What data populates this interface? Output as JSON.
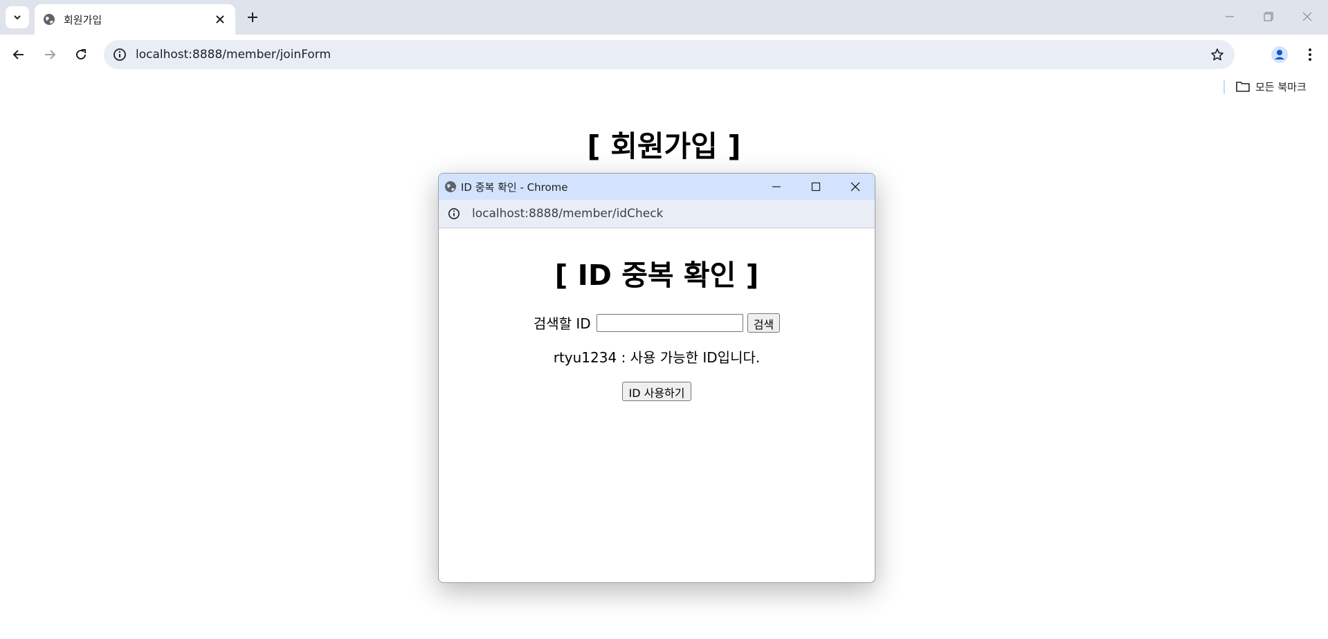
{
  "browser": {
    "tab_title": "회원가입",
    "url": "localhost:8888/member/joinForm",
    "bookmarks_all_label": "모든 북마크"
  },
  "page": {
    "heading": "[ 회원가입 ]"
  },
  "popup": {
    "window_title": "ID 중복 확인 - Chrome",
    "url": "localhost:8888/member/idCheck",
    "heading": "[ ID 중복 확인 ]",
    "search_label": "검색할 ID",
    "search_value": "",
    "search_button": "검색",
    "result_id": "rtyu1234",
    "result_message": " : 사용 가능한 ID입니다.",
    "use_button": "ID 사용하기"
  },
  "icons": [
    "tab-search-icon",
    "globe-icon",
    "close-icon",
    "plus-icon",
    "minimize-icon",
    "maximize-icon",
    "back-icon",
    "forward-icon",
    "reload-icon",
    "info-icon",
    "star-icon",
    "profile-icon",
    "more-icon",
    "folder-icon"
  ],
  "colors": {
    "tabstrip_bg": "#dfe3eb",
    "omnibox_bg": "#e9edf6",
    "popup_titlebar_bg": "#d3e3fd",
    "profile_accent": "#0b57d0"
  }
}
